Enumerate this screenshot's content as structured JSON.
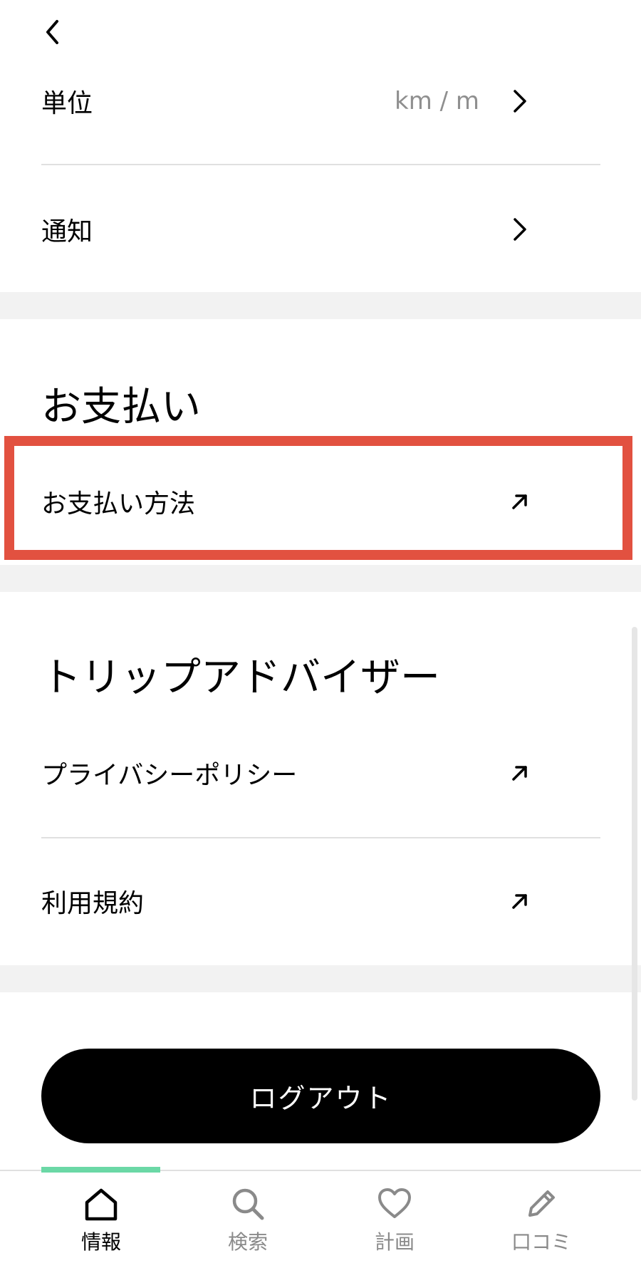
{
  "settings": {
    "unit_label": "単位",
    "unit_value": "km / m",
    "notification_label": "通知"
  },
  "payment": {
    "title": "お支払い",
    "method_label": "お支払い方法"
  },
  "tripadvisor": {
    "title": "トリップアドバイザー",
    "privacy_label": "プライバシーポリシー",
    "terms_label": "利用規約"
  },
  "logout_label": "ログアウト",
  "tabbar": {
    "tabs": [
      {
        "label": "情報",
        "icon": "home-icon",
        "active": true
      },
      {
        "label": "検索",
        "icon": "search-icon",
        "active": false
      },
      {
        "label": "計画",
        "icon": "heart-icon",
        "active": false
      },
      {
        "label": "口コミ",
        "icon": "pencil-icon",
        "active": false
      }
    ]
  },
  "colors": {
    "highlight": "#e25140",
    "active_indicator": "#6bd8a6",
    "logout_bg": "#000000"
  }
}
